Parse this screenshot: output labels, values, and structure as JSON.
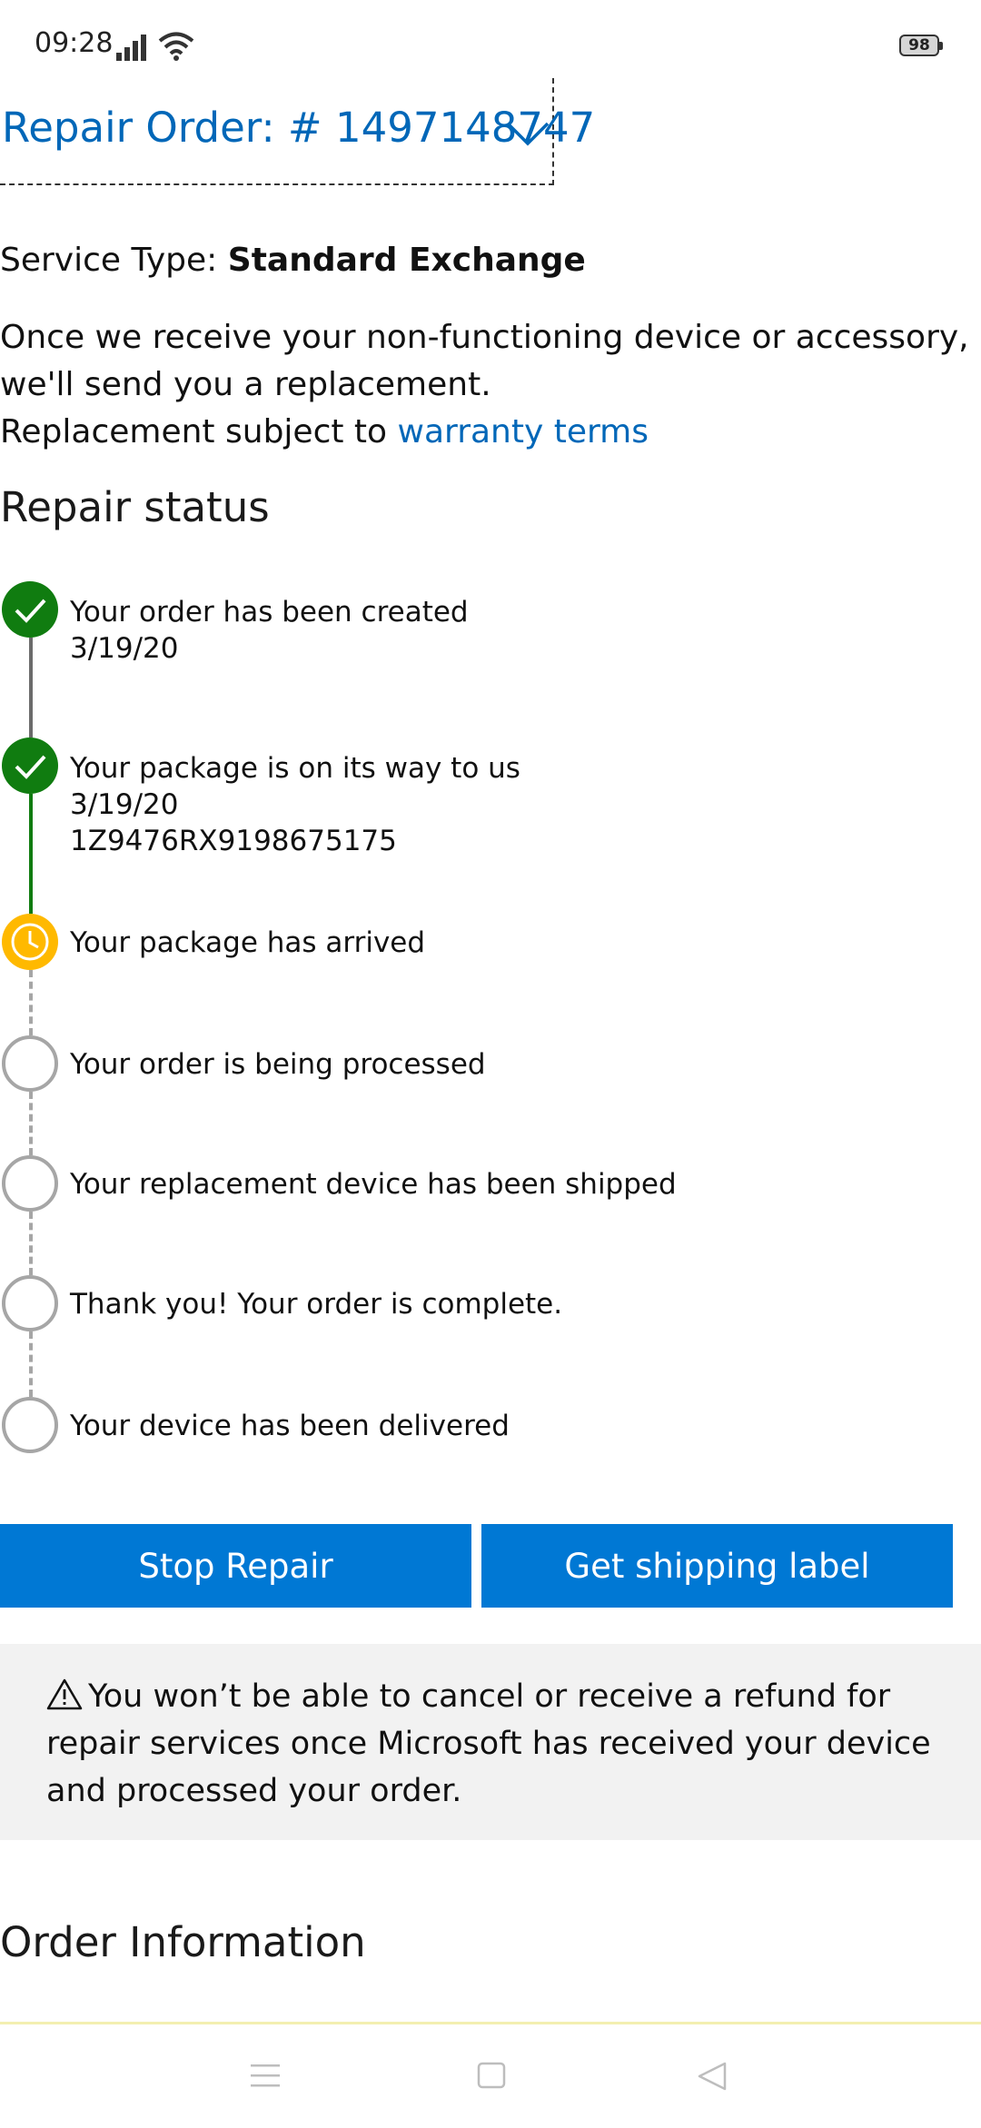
{
  "status_bar": {
    "time": "09:28",
    "battery": "98"
  },
  "order": {
    "title": "Repair Order: # 1497148747"
  },
  "service": {
    "label": "Service Type: ",
    "value": "Standard Exchange",
    "description": "Once we receive your non-functioning device or accessory, we'll send you a replacement.",
    "warranty_prefix": "Replacement subject to ",
    "warranty_link": "warranty terms"
  },
  "repair_status": {
    "title": "Repair status",
    "steps": [
      {
        "state": "done",
        "label": "Your order has been created",
        "date": "3/19/20"
      },
      {
        "state": "done",
        "label": "Your package is on its way to us",
        "date": "3/19/20",
        "tracking": "1Z9476RX9198675175"
      },
      {
        "state": "active",
        "label": "Your package has arrived"
      },
      {
        "state": "pending",
        "label": "Your order is being processed"
      },
      {
        "state": "pending",
        "label": "Your replacement device has been shipped"
      },
      {
        "state": "pending",
        "label": "Thank you! Your order is complete."
      },
      {
        "state": "pending",
        "label": "Your device has been delivered"
      }
    ]
  },
  "buttons": {
    "stop_repair": "Stop Repair",
    "shipping_label": "Get shipping label"
  },
  "notice": {
    "text": "You won’t be able to cancel or receive a refund for repair services once Microsoft has received your device and processed your order."
  },
  "order_information": {
    "title": "Order Information"
  },
  "colors": {
    "accent": "#0067b8",
    "button": "#0078d4",
    "done": "#107c10",
    "active": "#ffb900",
    "pending": "#a6a6a6"
  },
  "icons": [
    "signal-icon",
    "wifi-icon",
    "battery-icon",
    "chevron-down-icon",
    "check-icon",
    "clock-icon",
    "warning-icon",
    "menu-icon",
    "home-icon",
    "back-icon"
  ]
}
